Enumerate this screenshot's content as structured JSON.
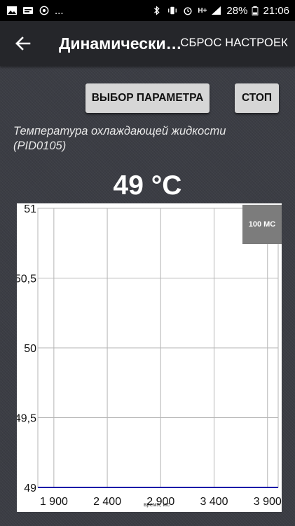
{
  "status_bar": {
    "dots": "...",
    "battery": "28%",
    "time": "21:06",
    "network": "H+"
  },
  "app_bar": {
    "title": "Динамически…",
    "reset_label": "СБРОС НАСТРОЕК"
  },
  "controls": {
    "select_param_label": "ВЫБОР ПАРАМЕТРА",
    "stop_label": "СТОП"
  },
  "parameter": {
    "name": "Температура охлаждающей жидкости (PID0105)",
    "value": "49 °C"
  },
  "chart_data": {
    "type": "line",
    "interval_label": "100 МС",
    "xlabel": "время, мс",
    "ylabel": "",
    "xlim": [
      1750,
      4000
    ],
    "ylim": [
      49,
      51
    ],
    "x_ticks": [
      1900,
      2400,
      2900,
      3400,
      3900
    ],
    "x_tick_labels": [
      "1 900",
      "2 400",
      "2 900",
      "3 400",
      "3 900"
    ],
    "y_ticks": [
      49,
      49.5,
      50,
      50.5,
      51
    ],
    "y_tick_labels": [
      "49",
      "49,5",
      "50",
      "50,5",
      "51"
    ],
    "grid": true,
    "series": [
      {
        "color": "#1a1aa8",
        "x": [
          1750,
          4000
        ],
        "y": [
          49,
          49
        ]
      }
    ]
  }
}
